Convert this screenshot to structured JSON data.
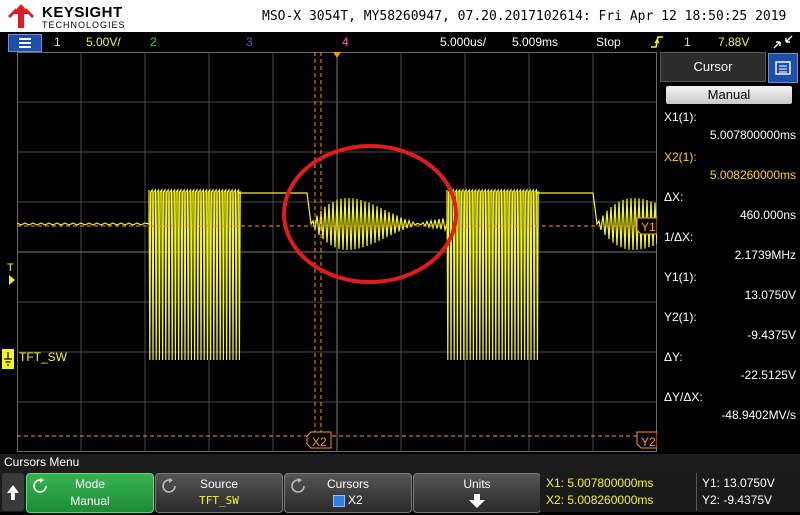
{
  "header": {
    "brand": "KEYSIGHT",
    "brand_sub": "TECHNOLOGIES",
    "title": "MSO-X 3054T, MY58260947, 07.20.2017102614: Fri Apr 12 18:50:25 2019"
  },
  "status": {
    "ch1_num": "1",
    "ch1_scale": "5.00V/",
    "ch2_num": "2",
    "ch3_num": "3",
    "ch4_num": "4",
    "timebase": "5.000us/",
    "delay": "5.009ms",
    "run_state": "Stop",
    "trigger_source": "1",
    "trigger_level": "7.88V"
  },
  "grid_labels": {
    "trigger_marker": "T",
    "channel_label": "TFT_SW",
    "x2_marker": "X2",
    "y1_marker": "Y1",
    "y2_marker": "Y2"
  },
  "panel": {
    "title": "Cursor",
    "mode_button": "Manual",
    "rows": [
      {
        "label": "X1(1):",
        "value": "5.007800000ms",
        "color": "#ffffff"
      },
      {
        "label": "X2(1):",
        "value": "5.008260000ms",
        "color": "#ffd21f"
      },
      {
        "label": "ΔX:",
        "value": "460.000ns",
        "color": "#ffffff"
      },
      {
        "label": "1/ΔX:",
        "value": "2.1739MHz",
        "color": "#ffffff"
      },
      {
        "label": "Y1(1):",
        "value": "13.0750V",
        "color": "#ffffff"
      },
      {
        "label": "Y2(1):",
        "value": "-9.4375V",
        "color": "#ffffff"
      },
      {
        "label": "ΔY:",
        "value": "-22.5125V",
        "color": "#ffffff"
      },
      {
        "label": "ΔY/ΔX:",
        "value": "-48.9402MV/s",
        "color": "#ffffff"
      }
    ]
  },
  "softkeys": {
    "menu_title": "Cursors Menu",
    "mode_title": "Mode",
    "mode_value": "Manual",
    "source_title": "Source",
    "source_value": "TFT_SW",
    "cursors_title": "Cursors",
    "cursors_value": "X2",
    "units_title": "Units"
  },
  "readout": {
    "x1": "X1: 5.007800000ms",
    "x2": "X2: 5.008260000ms",
    "y1": "Y1: 13.0750V",
    "y2": "Y2: -9.4375V"
  },
  "colors": {
    "ch1": "#f5f51e",
    "ch2": "#2edb2e",
    "ch3": "#3b5cff",
    "ch4": "#ff4dd2",
    "cursor": "#ff9900",
    "annotation": "#e31b1b",
    "softkey_active": "#2fa84a"
  },
  "icons": [
    "menu-icon",
    "trigger-edge-icon",
    "resize-icon",
    "panel-menu-icon",
    "back-arrow-icon",
    "refresh-icon",
    "down-arrow-icon",
    "ground-icon"
  ]
}
